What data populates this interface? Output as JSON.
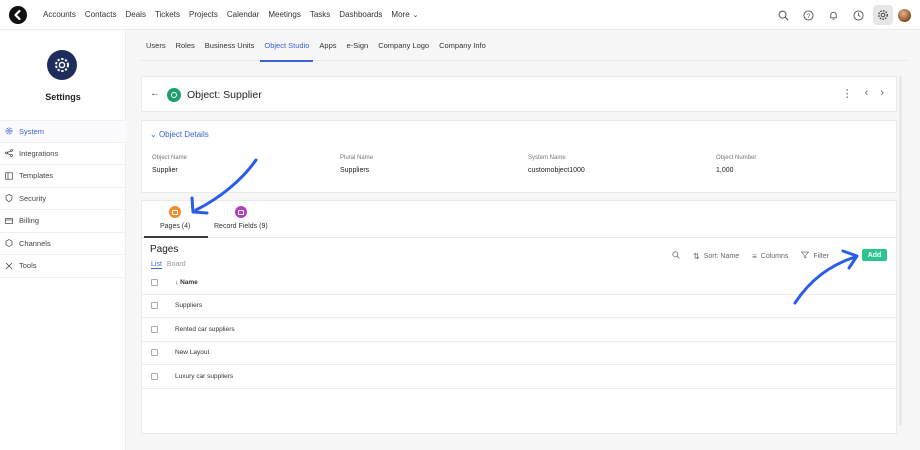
{
  "topnav": {
    "items": [
      "Accounts",
      "Contacts",
      "Deals",
      "Tickets",
      "Projects",
      "Calendar",
      "Meetings",
      "Tasks",
      "Dashboards"
    ],
    "more_label": "More"
  },
  "sidebar": {
    "title": "Settings",
    "items": [
      {
        "label": "System",
        "icon": "gear-icon"
      },
      {
        "label": "Integrations",
        "icon": "share-icon"
      },
      {
        "label": "Templates",
        "icon": "template-icon"
      },
      {
        "label": "Security",
        "icon": "shield-icon"
      },
      {
        "label": "Billing",
        "icon": "card-icon"
      },
      {
        "label": "Channels",
        "icon": "hexagon-icon"
      },
      {
        "label": "Tools",
        "icon": "tools-icon"
      }
    ]
  },
  "subtabs": [
    "Users",
    "Roles",
    "Business Units",
    "Object Studio",
    "Apps",
    "e-Sign",
    "Company Logo",
    "Company Info"
  ],
  "header": {
    "title": "Object: Supplier"
  },
  "details": {
    "toggle_label": "Object Details",
    "fields": [
      {
        "label": "Object Name",
        "value": "Supplier"
      },
      {
        "label": "Plural Name",
        "value": "Suppliers"
      },
      {
        "label": "System Name",
        "value": "customobject1000"
      },
      {
        "label": "Object Number",
        "value": "1,000"
      }
    ]
  },
  "pages": {
    "tabs": [
      {
        "label": "Pages (4)",
        "color": "#f28b2c"
      },
      {
        "label": "Record Fields (9)",
        "color": "#b23fbf"
      }
    ],
    "heading": "Pages",
    "view_list": "List",
    "view_board": "Board",
    "sort_label": "Sort: Name",
    "columns_label": "Columns",
    "filter_label": "Filter",
    "add_label": "Add",
    "name_header": "Name",
    "rows": [
      "Suppliers",
      "Rented car suppliers",
      "New Layout",
      "Luxury car suppliers"
    ]
  },
  "colors": {
    "accent": "#3a63d6",
    "add_button": "#2cc58e",
    "annotation_arrow": "#2b5ee8"
  }
}
